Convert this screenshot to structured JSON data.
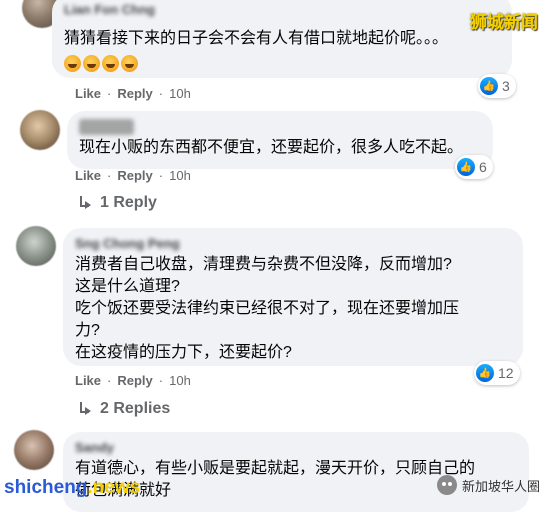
{
  "watermarks": {
    "top_right": "狮城新闻",
    "bottom_left_prefix": "shicheng",
    "bottom_left_suffix": ".news",
    "bottom_right": "新加坡华人圈"
  },
  "comments": [
    {
      "name": "Lian Fon Chng",
      "text": "猜猜看接下来的日子会不会有人有借口就地起价呢。。。",
      "emoji_count": 4,
      "like_label": "Like",
      "reply_label": "Reply",
      "time": "10h",
      "reactions": "3"
    },
    {
      "name": "",
      "text": "现在小贩的东西都不便宜，还要起价，很多人吃不起。",
      "like_label": "Like",
      "reply_label": "Reply",
      "time": "10h",
      "reactions": "6",
      "replies_label": "1 Reply"
    },
    {
      "name": "Sng Chong Peng",
      "text": "消费者自己收盘，清理费与杂费不但没降，反而增加?\n这是什么道理?\n吃个饭还要受法律约束已经很不对了，现在还要增加压\n力?\n在这疫情的压力下，还要起价?",
      "like_label": "Like",
      "reply_label": "Reply",
      "time": "10h",
      "reactions": "12",
      "replies_label": "2 Replies"
    },
    {
      "name": "Sandy",
      "text": "有道德心，有些小贩是要起就起，漫天开价，只顾自己的\n荷包满满就好"
    }
  ]
}
